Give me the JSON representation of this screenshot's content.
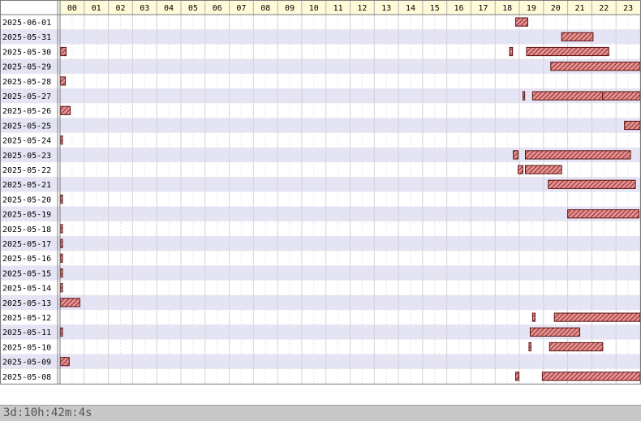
{
  "colors": {
    "row_band": "#e4e4f4",
    "header_bg": "#fffbd8",
    "bar_fill": "#e89090",
    "bar_stroke": "#5a1010",
    "hatch": "#6a1818",
    "grid_hour": "#d4d4d4",
    "grid_half": "#e6e6e6"
  },
  "footer": {
    "total": "3d:10h:42m:4s"
  },
  "chart_data": {
    "type": "gantt",
    "title": "",
    "x_axis": {
      "unit": "hour",
      "range": [
        0,
        24
      ],
      "ticks": [
        "00",
        "01",
        "02",
        "03",
        "04",
        "05",
        "06",
        "07",
        "08",
        "09",
        "10",
        "11",
        "12",
        "13",
        "14",
        "15",
        "16",
        "17",
        "18",
        "19",
        "20",
        "21",
        "22",
        "23"
      ]
    },
    "grid": true,
    "rows": [
      {
        "date": "2025-06-01",
        "bars": [
          [
            18.85,
            19.35
          ]
        ]
      },
      {
        "date": "2025-05-31",
        "bars": [
          [
            20.75,
            22.05
          ]
        ]
      },
      {
        "date": "2025-05-30",
        "bars": [
          [
            0.02,
            0.25
          ],
          [
            18.6,
            18.72
          ],
          [
            19.3,
            22.7
          ]
        ]
      },
      {
        "date": "2025-05-29",
        "bars": [
          [
            20.3,
            24.0
          ]
        ]
      },
      {
        "date": "2025-05-28",
        "bars": [
          [
            0.02,
            0.22
          ]
        ]
      },
      {
        "date": "2025-05-27",
        "bars": [
          [
            19.15,
            19.22
          ],
          [
            19.55,
            22.45
          ],
          [
            22.45,
            24.0
          ]
        ]
      },
      {
        "date": "2025-05-26",
        "bars": [
          [
            0.02,
            0.42
          ]
        ]
      },
      {
        "date": "2025-05-25",
        "bars": [
          [
            23.35,
            24.0
          ]
        ]
      },
      {
        "date": "2025-05-24",
        "bars": [
          [
            0.02,
            0.1
          ]
        ]
      },
      {
        "date": "2025-05-23",
        "bars": [
          [
            18.75,
            18.95
          ],
          [
            19.25,
            23.6
          ]
        ]
      },
      {
        "date": "2025-05-22",
        "bars": [
          [
            18.95,
            19.15
          ],
          [
            19.25,
            20.75
          ]
        ]
      },
      {
        "date": "2025-05-21",
        "bars": [
          [
            20.2,
            23.8
          ]
        ]
      },
      {
        "date": "2025-05-20",
        "bars": [
          [
            0.02,
            0.1
          ]
        ]
      },
      {
        "date": "2025-05-19",
        "bars": [
          [
            21.0,
            23.95
          ]
        ]
      },
      {
        "date": "2025-05-18",
        "bars": [
          [
            0.02,
            0.1
          ]
        ]
      },
      {
        "date": "2025-05-17",
        "bars": [
          [
            0.02,
            0.1
          ]
        ]
      },
      {
        "date": "2025-05-16",
        "bars": [
          [
            0.02,
            0.1
          ]
        ]
      },
      {
        "date": "2025-05-15",
        "bars": [
          [
            0.02,
            0.1
          ]
        ]
      },
      {
        "date": "2025-05-14",
        "bars": [
          [
            0.02,
            0.1
          ]
        ]
      },
      {
        "date": "2025-05-13",
        "bars": [
          [
            0.02,
            0.82
          ]
        ]
      },
      {
        "date": "2025-05-12",
        "bars": [
          [
            19.55,
            19.65
          ],
          [
            20.45,
            24.0
          ]
        ]
      },
      {
        "date": "2025-05-11",
        "bars": [
          [
            0.02,
            0.1
          ],
          [
            19.45,
            21.5
          ]
        ]
      },
      {
        "date": "2025-05-10",
        "bars": [
          [
            19.4,
            19.48
          ],
          [
            20.25,
            22.45
          ]
        ]
      },
      {
        "date": "2025-05-09",
        "bars": [
          [
            0.02,
            0.38
          ]
        ]
      },
      {
        "date": "2025-05-08",
        "bars": [
          [
            18.85,
            18.98
          ],
          [
            19.95,
            24.0
          ]
        ]
      }
    ]
  }
}
